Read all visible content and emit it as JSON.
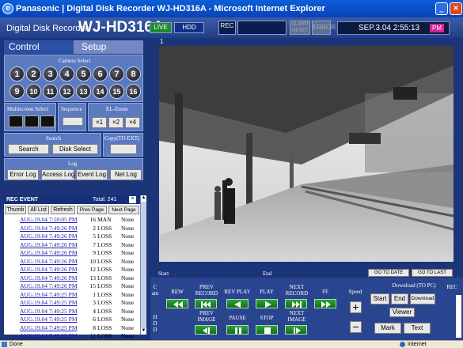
{
  "window": {
    "title": "Panasonic | Digital Disk Recorder WJ-HD316A - Microsoft Internet Explorer"
  },
  "header": {
    "brand_prefix": "Digital Disk Recorder",
    "brand_model": "WJ-HD316A",
    "live": "LIVE",
    "hdd": "HDD",
    "rec": "REC",
    "alarm": "ALARM RESET",
    "error": "ERROR",
    "datetime": "SEP.3.04  2:55:13",
    "ampm": "PM"
  },
  "tabs": {
    "control": "Control",
    "setup": "Setup"
  },
  "camera_select": {
    "label": "Camera Select",
    "cameras": [
      "1",
      "2",
      "3",
      "4",
      "5",
      "6",
      "7",
      "8",
      "9",
      "10",
      "11",
      "12",
      "13",
      "14",
      "15",
      "16"
    ]
  },
  "multiscreen": {
    "label": "Multiscreen Select"
  },
  "sequence": {
    "label": "Sequence"
  },
  "elzoom": {
    "label": "EL-Zoom",
    "x1": "×1",
    "x2": "×2",
    "x4": "×4"
  },
  "search": {
    "label": "Search",
    "search": "Search",
    "disk": "Disk Select"
  },
  "copy": {
    "label": "Copy(TO EXT)"
  },
  "log": {
    "label": "Log",
    "error": "Error Log",
    "access": "Access Log",
    "event": "Event Log",
    "net": "Net Log"
  },
  "rec_event": {
    "title": "REC EVENT",
    "total": "Total: 241",
    "thumb": "Thumb",
    "all": "All List",
    "refresh": "Refresh",
    "prev": "Prev Page",
    "next": "Next Page",
    "rows": [
      {
        "date": "AUG.19.04  7:50:05 PM",
        "ch": "16",
        "type": "MAN",
        "status": "None"
      },
      {
        "date": "AUG.19.04  7:49:26 PM",
        "ch": "2",
        "type": "LOSS",
        "status": "None"
      },
      {
        "date": "AUG.19.04  7:49:26 PM",
        "ch": "5",
        "type": "LOSS",
        "status": "None"
      },
      {
        "date": "AUG.19.04  7:49:26 PM",
        "ch": "7",
        "type": "LOSS",
        "status": "None"
      },
      {
        "date": "AUG.19.04  7:49:26 PM",
        "ch": "9",
        "type": "LOSS",
        "status": "None"
      },
      {
        "date": "AUG.19.04  7:49:26 PM",
        "ch": "10",
        "type": "LOSS",
        "status": "None"
      },
      {
        "date": "AUG.19.04  7:49:26 PM",
        "ch": "12",
        "type": "LOSS",
        "status": "None"
      },
      {
        "date": "AUG.19.04  7:49:26 PM",
        "ch": "13",
        "type": "LOSS",
        "status": "None"
      },
      {
        "date": "AUG.19.04  7:49:26 PM",
        "ch": "15",
        "type": "LOSS",
        "status": "None"
      },
      {
        "date": "AUG.19.04  7:49:25 PM",
        "ch": "1",
        "type": "LOSS",
        "status": "None"
      },
      {
        "date": "AUG.19.04  7:49:25 PM",
        "ch": "3",
        "type": "LOSS",
        "status": "None"
      },
      {
        "date": "AUG.19.04  7:49:25 PM",
        "ch": "4",
        "type": "LOSS",
        "status": "None"
      },
      {
        "date": "AUG.19.04  7:49:25 PM",
        "ch": "6",
        "type": "LOSS",
        "status": "None"
      },
      {
        "date": "AUG.19.04  7:49:25 PM",
        "ch": "8",
        "type": "LOSS",
        "status": "None"
      },
      {
        "date": "AUG.19.04  7:49:25 PM",
        "ch": "11",
        "type": "LOSS",
        "status": "None"
      }
    ]
  },
  "camera_view": {
    "channel": "1"
  },
  "timeline": {
    "start": "Start",
    "end": "End",
    "goto_date": "GO TO DATE",
    "goto_last": "GO TO LAST"
  },
  "transport": {
    "side_top": "C\nam",
    "side_bottom": "H\nD\nD",
    "rew": "REW",
    "prev_record": "PREV\nRECORD",
    "rev_play": "REV PLAY",
    "play": "PLAY",
    "next_record": "NEXT\nRECORD",
    "ff": "FF",
    "prev_image": "PREV\nIMAGE",
    "pause": "PAUSE",
    "stop": "STOP",
    "next_image": "NEXT\nIMAGE",
    "speed": "Speed"
  },
  "download": {
    "label": "Download (TO PC)",
    "start": "Start",
    "end": "End",
    "download": "Download",
    "viewer": "Viewer",
    "mark": "Mark",
    "text": "Text"
  },
  "rec": {
    "label": "REC"
  },
  "statusbar": {
    "done": "Done",
    "zone": "Internet"
  }
}
